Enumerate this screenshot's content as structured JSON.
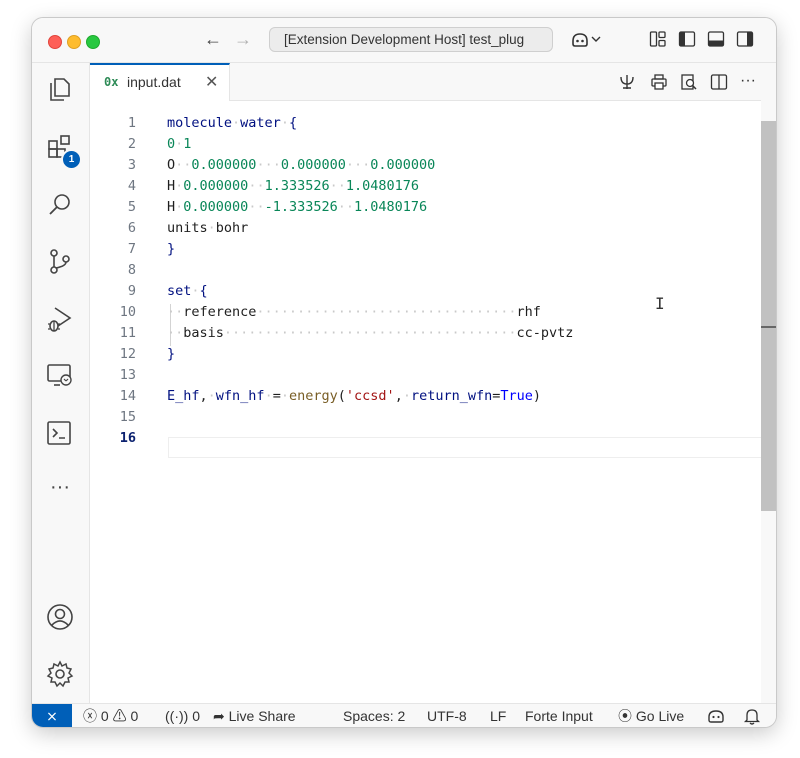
{
  "window": {
    "title": "[Extension Development Host] test_plug"
  },
  "titlebar": {
    "back_icon": "←",
    "forward_icon": "→"
  },
  "activity_bar": {
    "items": [
      {
        "name": "explorer-icon"
      },
      {
        "name": "extensions-icon",
        "badge": "1"
      },
      {
        "name": "search-icon"
      },
      {
        "name": "source-control-icon"
      },
      {
        "name": "run-debug-icon"
      },
      {
        "name": "remote-explorer-icon"
      },
      {
        "name": "terminal-icon"
      },
      {
        "name": "more-icon",
        "glyph": "···"
      },
      {
        "name": "accounts-icon"
      },
      {
        "name": "settings-gear-icon"
      }
    ]
  },
  "editor": {
    "tab": {
      "icon": "0x",
      "label": "input.dat",
      "close": "✕"
    },
    "line_numbers": [
      "1",
      "2",
      "3",
      "4",
      "5",
      "6",
      "7",
      "8",
      "9",
      "10",
      "11",
      "12",
      "13",
      "14",
      "15",
      "16"
    ],
    "active_line": "16"
  },
  "statusbar": {
    "remote_icon": "⨯",
    "errors": "0",
    "warnings": "0",
    "ports": "0",
    "live_share": "Live Share",
    "spaces": "Spaces: 2",
    "encoding": "UTF-8",
    "eol": "LF",
    "language": "Forte Input",
    "go_live": "Go Live"
  },
  "colors": {
    "accent": "#005fb8",
    "keyword": "#0000ff",
    "number": "#098658",
    "string": "#a31515",
    "function": "#795e26"
  }
}
